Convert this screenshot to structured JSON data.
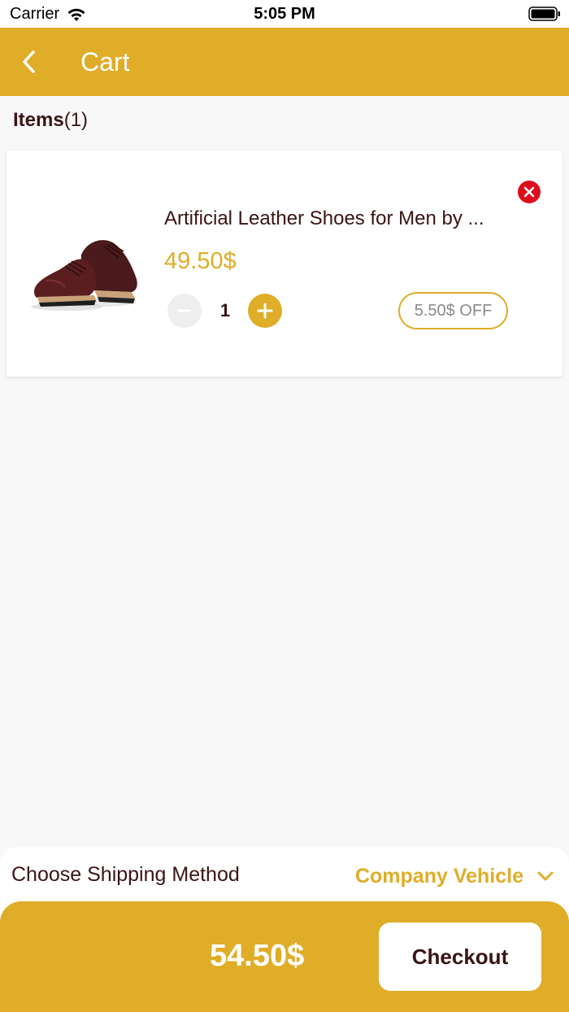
{
  "status_bar": {
    "carrier": "Carrier",
    "time": "5:05 PM"
  },
  "header": {
    "title": "Cart",
    "back_icon": "chevron-left-icon"
  },
  "items_section": {
    "label": "Items",
    "count": "(1)"
  },
  "cart_items": [
    {
      "name": "Artificial Leather Shoes for Men by ...",
      "price": "49.50$",
      "quantity": "1",
      "discount": "5.50$ OFF",
      "image": "brown-leather-shoes"
    }
  ],
  "shipping": {
    "label": "Choose Shipping Method",
    "value": "Company Vehicle"
  },
  "footer": {
    "total": "54.50$",
    "checkout_label": "Checkout"
  },
  "colors": {
    "accent": "#dfad28",
    "text": "#3a1416",
    "remove": "#dd0f1c",
    "background": "#f8f8f8"
  }
}
